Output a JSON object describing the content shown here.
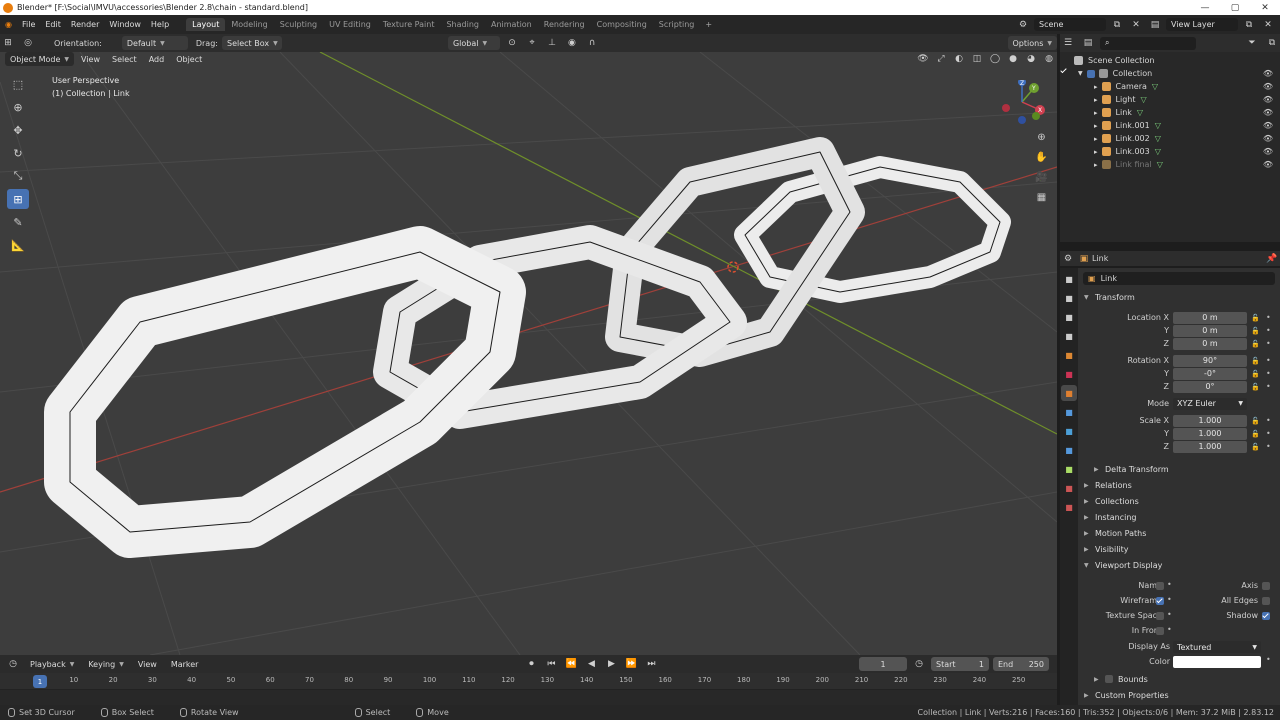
{
  "window": {
    "title": "Blender* [F:\\Social\\IMVU\\accessories\\Blender 2.8\\chain - standard.blend]",
    "controls": [
      "—",
      "▢",
      "✕"
    ]
  },
  "menu": {
    "items": [
      "File",
      "Edit",
      "Render",
      "Window",
      "Help"
    ],
    "workspaces": [
      "Layout",
      "Modeling",
      "Sculpting",
      "UV Editing",
      "Texture Paint",
      "Shading",
      "Animation",
      "Rendering",
      "Compositing",
      "Scripting"
    ],
    "active_workspace": "Layout",
    "add_label": "+"
  },
  "top_right": {
    "scene": "Scene",
    "view_layer": "View Layer"
  },
  "viewport_header": {
    "orientation_label": "Orientation:",
    "orientation_value": "Default",
    "drag_label": "Drag:",
    "drag_value": "Select Box",
    "transform_space": "Global",
    "options_label": "Options"
  },
  "viewport_menu": {
    "mode": "Object Mode",
    "items": [
      "View",
      "Select",
      "Add",
      "Object"
    ]
  },
  "viewport": {
    "perspective": "User Perspective",
    "collection_info": "(1) Collection | Link"
  },
  "gizmo": {
    "x": "X",
    "y": "Y",
    "z": "Z"
  },
  "timeline": {
    "menus": [
      "Playback",
      "Keying",
      "View",
      "Marker"
    ],
    "current_frame": "1",
    "start_label": "Start",
    "start_value": "1",
    "end_label": "End",
    "end_value": "250",
    "ruler_ticks": [
      "1",
      "10",
      "20",
      "30",
      "40",
      "50",
      "60",
      "70",
      "80",
      "90",
      "100",
      "110",
      "120",
      "130",
      "140",
      "150",
      "160",
      "170",
      "180",
      "190",
      "200",
      "210",
      "220",
      "230",
      "240",
      "250"
    ],
    "transport": [
      "⏺",
      "⏮",
      "⏪",
      "◀",
      "▶",
      "⏩",
      "⏭"
    ]
  },
  "statusbar": {
    "hints": [
      "Set 3D Cursor",
      "Box Select",
      "Rotate View",
      "Select",
      "Move"
    ],
    "stats": "Collection | Link | Verts:216 | Faces:160 | Tris:352 | Objects:0/6 | Mem: 37.2 MiB | 2.83.12"
  },
  "outliner": {
    "root": "Scene Collection",
    "collection": "Collection",
    "objects": [
      {
        "name": "Camera",
        "color": "#e0a050"
      },
      {
        "name": "Light",
        "color": "#e0a050"
      },
      {
        "name": "Link",
        "color": "#e0a050"
      },
      {
        "name": "Link.001",
        "color": "#e0a050"
      },
      {
        "name": "Link.002",
        "color": "#e0a050"
      },
      {
        "name": "Link.003",
        "color": "#e0a050"
      },
      {
        "name": "Link final",
        "color": "#8a7048"
      }
    ]
  },
  "properties": {
    "object_name": "Link",
    "header_name": "Link",
    "transform": {
      "title": "Transform",
      "location_label": "Location X",
      "location": [
        "0 m",
        "0 m",
        "0 m"
      ],
      "rotation_label": "Rotation X",
      "rotation": [
        "90°",
        "-0°",
        "0°"
      ],
      "mode_label": "Mode",
      "mode_value": "XYZ Euler",
      "scale_label": "Scale X",
      "scale": [
        "1.000",
        "1.000",
        "1.000"
      ],
      "y": "Y",
      "z": "Z"
    },
    "delta_transform": "Delta Transform",
    "panels": [
      "Relations",
      "Collections",
      "Instancing",
      "Motion Paths",
      "Visibility"
    ],
    "viewport_display": {
      "title": "Viewport Display",
      "name": "Name",
      "axis": "Axis",
      "wireframe": "Wireframe",
      "all_edges": "All Edges",
      "texture_space": "Texture Space",
      "shadow": "Shadow",
      "in_front": "In Front",
      "display_as_label": "Display As",
      "display_as_value": "Textured",
      "color_label": "Color",
      "bounds": "Bounds"
    },
    "custom_properties": "Custom Properties",
    "tab_colors": [
      "#cccccc",
      "#cccccc",
      "#cccccc",
      "#cccccc",
      "#dd8833",
      "#cc3355",
      "#e08030",
      "#5599dd",
      "#4ca0d8",
      "#5599dd",
      "#aadd66",
      "#cc5555",
      "#cc5555"
    ]
  }
}
